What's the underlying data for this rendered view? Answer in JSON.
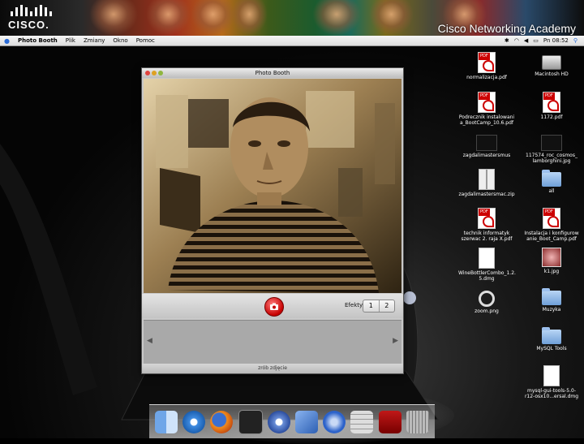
{
  "banner": {
    "logo_text": "CISCO.",
    "title": "Cisco Networking Academy"
  },
  "menubar": {
    "app_name": "Photo Booth",
    "items": [
      "Plik",
      "Zmiany",
      "Okno",
      "Pomoc"
    ],
    "clock": "Pn 08:52"
  },
  "window": {
    "title": "Photo Booth",
    "effects_label": "Efekty",
    "effects_options": [
      "1",
      "2"
    ],
    "status": "zrób zdjęcie"
  },
  "desktop_icons": [
    {
      "label": "normalizacja.pdf",
      "icon": "pdf-icon"
    },
    {
      "label": "Macintosh HD",
      "icon": "hard-drive-icon"
    },
    {
      "label": "Podrecznik instalowani a_BootCamp_10.6.pdf",
      "icon": "pdf-icon"
    },
    {
      "label": "1172.pdf",
      "icon": "pdf-icon"
    },
    {
      "label": "zagdalimastersmus",
      "icon": "folder-icon"
    },
    {
      "label": "117574_roc_cosmos_ lamborghini.jpg",
      "icon": "image-icon"
    },
    {
      "label": "zagdalimastersmac.zip",
      "icon": "zip-icon"
    },
    {
      "label": "all",
      "icon": "folder-icon"
    },
    {
      "label": "technik informatyk szerwac 2. raja X.pdf",
      "icon": "pdf-icon"
    },
    {
      "label": "Instalacja i konfigurow anie_Boot_Camp.pdf",
      "icon": "pdf-icon"
    },
    {
      "label": "WineBottlerCombo_1.2. 5.dmg",
      "icon": "disk-image-icon"
    },
    {
      "label": "k1.jpg",
      "icon": "image-icon"
    },
    {
      "label": "zoom.png",
      "icon": "magnifier-icon"
    },
    {
      "label": "Muzyka",
      "icon": "folder-icon"
    },
    {
      "label": "MySQL Tools",
      "icon": "folder-icon"
    },
    {
      "label": "mysql-gui-tools-5.0-r12-osx10...ersal.dmg",
      "icon": "disk-image-icon"
    }
  ],
  "dock_items": [
    "finder-icon",
    "safari-icon",
    "firefox-icon",
    "terminal-icon",
    "itunes-icon",
    "xcode-icon",
    "thunderbird-icon",
    "calculator-icon",
    "photo-booth-icon",
    "trash-icon"
  ]
}
